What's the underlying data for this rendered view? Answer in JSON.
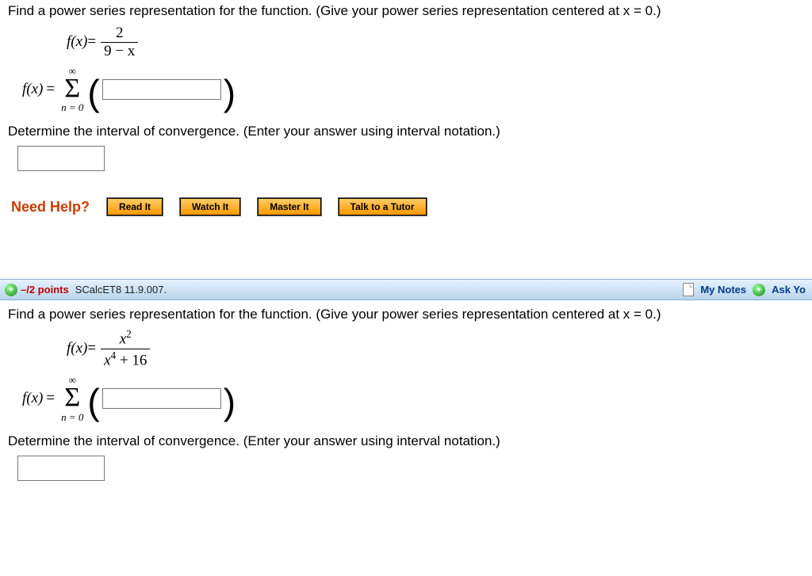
{
  "q1": {
    "prompt": "Find a power series representation for the function. (Give your power series representation centered at x = 0.)",
    "func_lhs": "f(x)",
    "equals": " = ",
    "frac_num": "2",
    "frac_den": "9 − x",
    "sum_lhs": "f(x)",
    "sigma_top": "∞",
    "sigma_bot": "n = 0",
    "interval_prompt": "Determine the interval of convergence. (Enter your answer using interval notation.)",
    "need_help": "Need Help?",
    "btn_read": "Read It",
    "btn_watch": "Watch It",
    "btn_master": "Master It",
    "btn_tutor": "Talk to a Tutor"
  },
  "header": {
    "points": "–/2 points",
    "source": "SCalcET8 11.9.007.",
    "my_notes": "My Notes",
    "ask": "Ask Yo"
  },
  "q2": {
    "prompt": "Find a power series representation for the function. (Give your power series representation centered at x = 0.)",
    "func_lhs": "f(x)",
    "equals": " = ",
    "frac_num_a": "x",
    "frac_num_sup": "2",
    "frac_den_a": "x",
    "frac_den_sup": "4",
    "frac_den_b": " + 16",
    "sum_lhs": "f(x)",
    "sigma_top": "∞",
    "sigma_bot": "n = 0",
    "interval_prompt": "Determine the interval of convergence. (Enter your answer using interval notation.)"
  }
}
